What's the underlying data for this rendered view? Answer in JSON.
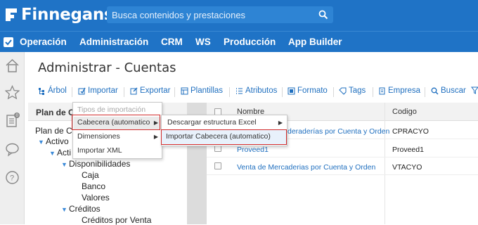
{
  "app": {
    "brand": "Finnegans"
  },
  "search": {
    "placeholder": "Busca contenidos y prestaciones"
  },
  "menubar": {
    "items": [
      "Operación",
      "Administración",
      "CRM",
      "WS",
      "Producción",
      "App Builder"
    ]
  },
  "page": {
    "title": "Administrar - Cuentas"
  },
  "toolbar": {
    "items": [
      "Árbol",
      "Importar",
      "Exportar",
      "Plantillas",
      "Atributos",
      "Formato",
      "Tags",
      "Empresa",
      "Buscar"
    ]
  },
  "left_panel": {
    "header": "Plan de Cu",
    "tree": [
      {
        "label": "Plan de C",
        "expanded": false
      },
      {
        "label": "Activo",
        "expanded": true
      },
      {
        "label": "Acti",
        "expanded": true
      },
      {
        "label": "Disponibilidades",
        "expanded": true
      },
      {
        "label": "Caja"
      },
      {
        "label": "Banco"
      },
      {
        "label": "Valores"
      },
      {
        "label": "Créditos",
        "expanded": true
      },
      {
        "label": "Créditos por Venta"
      }
    ]
  },
  "grid": {
    "columns": [
      "Nombre",
      "Codigo"
    ],
    "rows": [
      {
        "name": "deraderías por Cuenta y Orden",
        "code": "CPRACYO"
      },
      {
        "name": "Proveed1",
        "code": "Proveed1"
      },
      {
        "name": "Venta de Mercaderias por Cuenta y Orden",
        "code": "VTACYO"
      }
    ]
  },
  "import_menu": {
    "items": [
      "Tipos de importación",
      "Cabecera (automatico",
      "Dimensiones",
      "Importar XML"
    ]
  },
  "cabecera_submenu": {
    "items": [
      "Descargar estructura Excel",
      "Importar Cabecera (automatico)"
    ]
  },
  "colors": {
    "primary": "#1f73c6",
    "link": "#1f6fbf",
    "highlight": "#d22b2b"
  }
}
